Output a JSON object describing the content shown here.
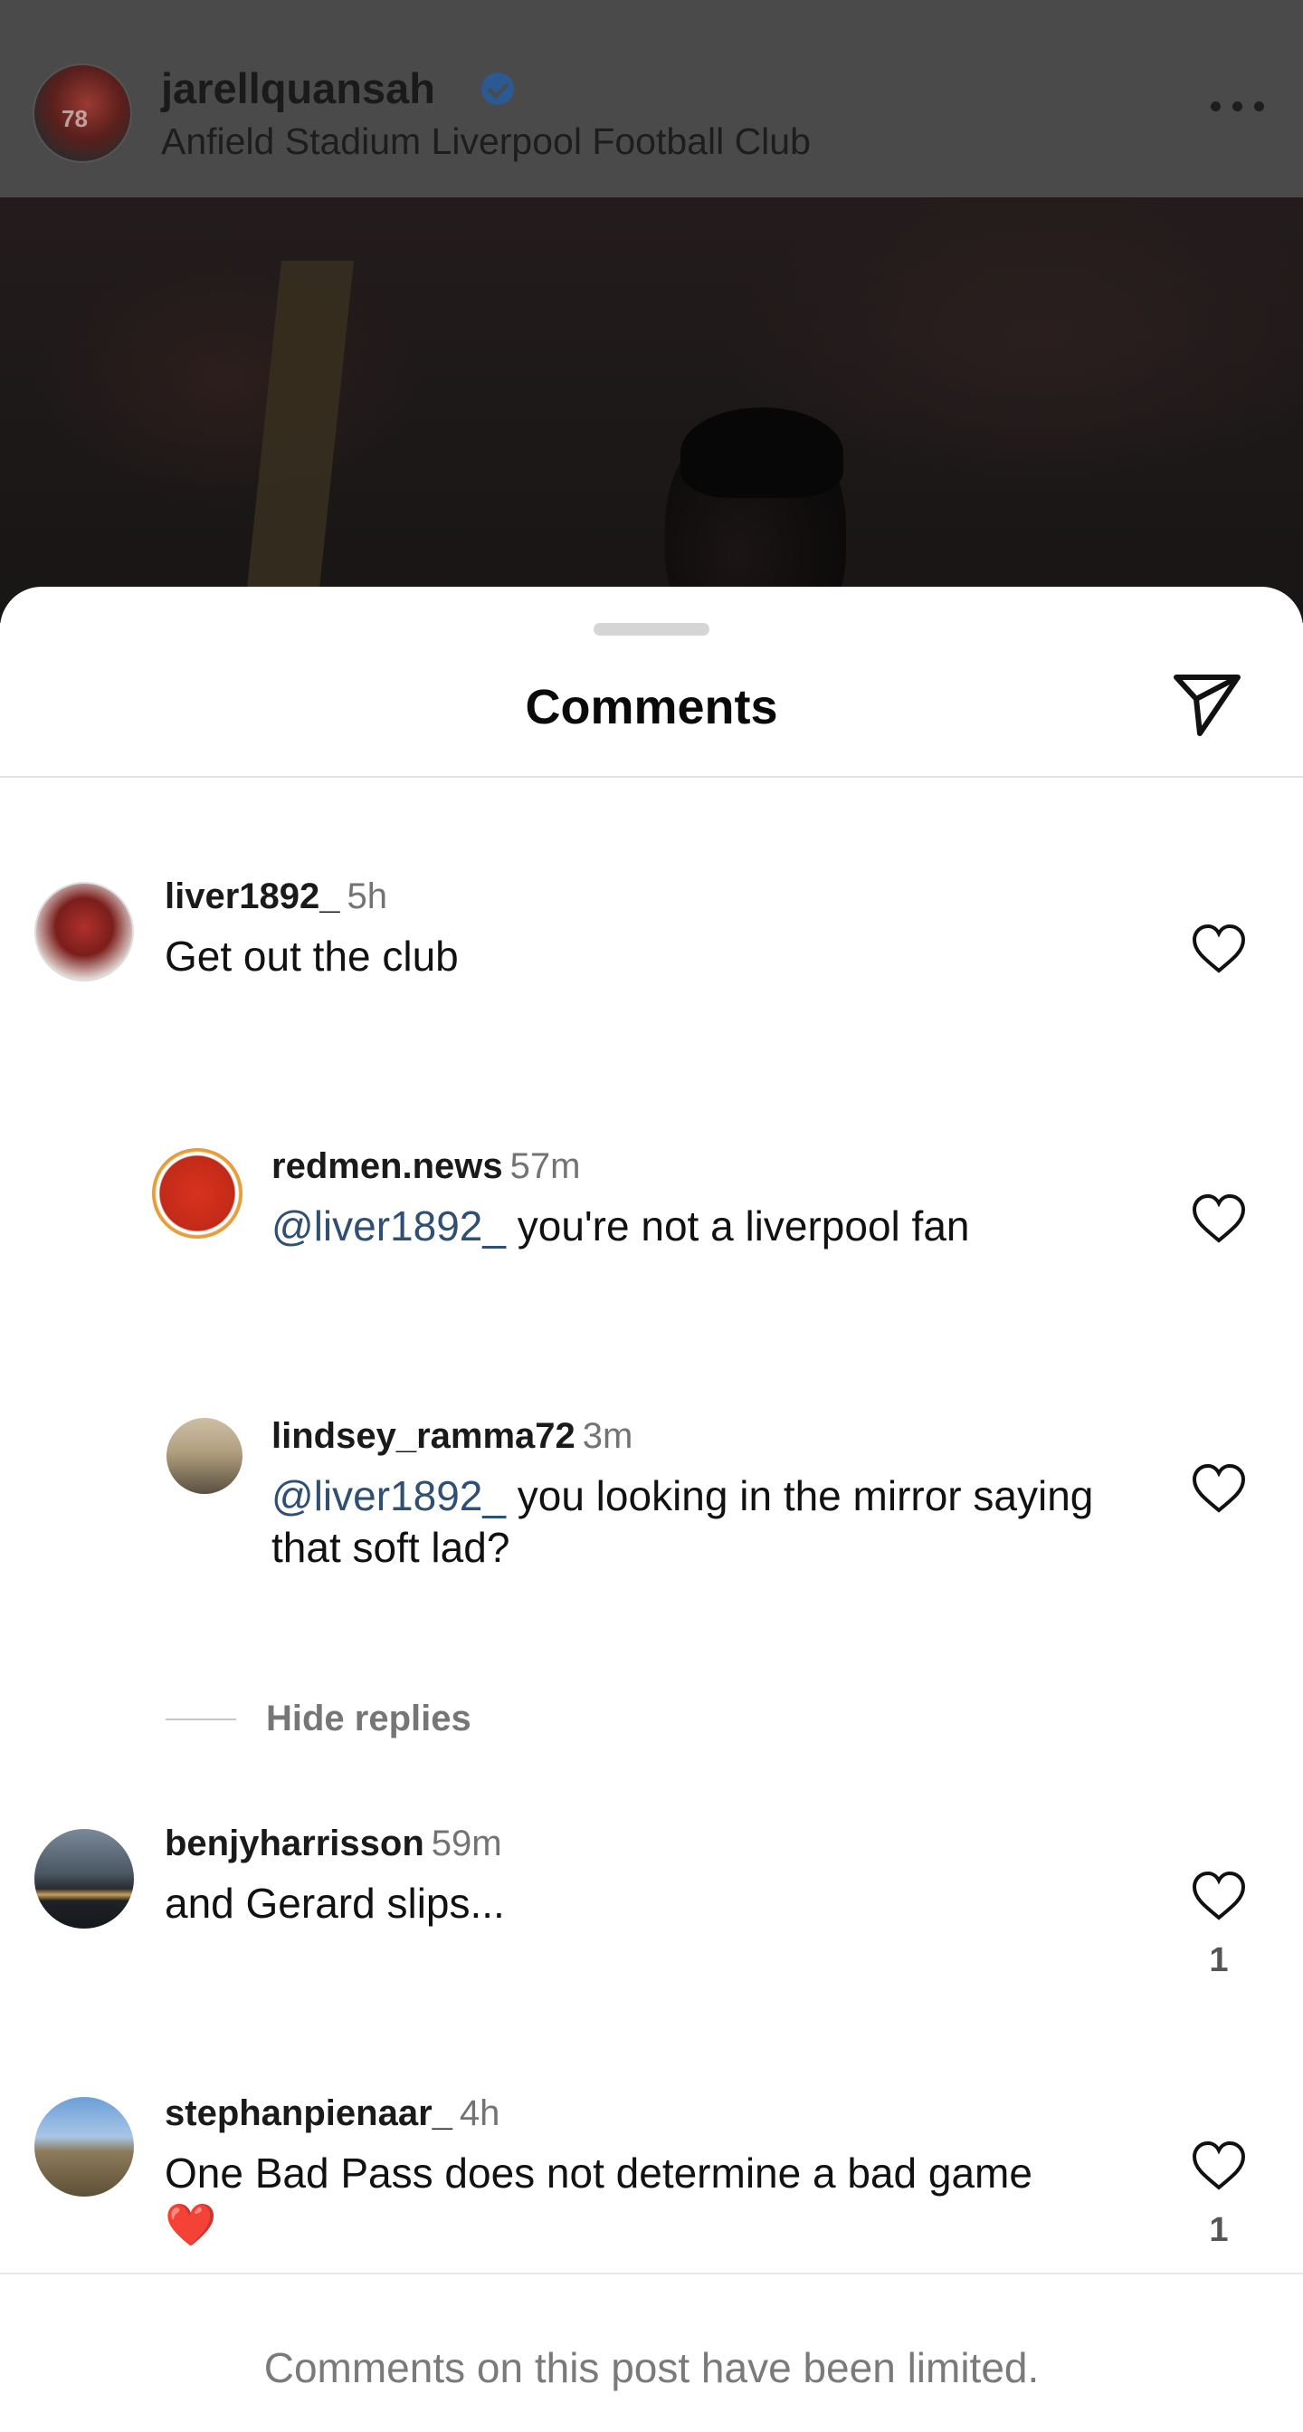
{
  "post": {
    "username": "jarellquansah",
    "location": "Anfield Stadium Liverpool Football Club",
    "avatar_number": "78"
  },
  "sheet": {
    "title": "Comments"
  },
  "comments": [
    {
      "username": "liver1892_",
      "time": "5h",
      "text": "Get out the club",
      "likes": ""
    },
    {
      "username": "redmen.news",
      "time": "57m",
      "mention": "@liver1892_",
      "text": " you're not a liverpool fan",
      "likes": ""
    },
    {
      "username": "lindsey_ramma72",
      "time": "3m",
      "mention": "@liver1892_",
      "text": " you looking in the mirror saying that soft lad?",
      "likes": ""
    },
    {
      "username": "benjyharrisson",
      "time": "59m",
      "text": "and Gerard slips...",
      "likes": "1"
    },
    {
      "username": "stephanpienaar_",
      "time": "4h",
      "text": "One Bad Pass does not determine a bad game ❤️",
      "likes": "1"
    }
  ],
  "replies_toggle": "Hide replies",
  "footer": {
    "note": "Comments on this post have been limited."
  },
  "colors": {
    "mention": "#2f4f75",
    "verified": "#2b5a92",
    "heart_outline": "#111111",
    "muted_text": "#737373"
  },
  "icons": [
    "verified-icon",
    "more-icon",
    "share-icon",
    "heart-icon"
  ]
}
